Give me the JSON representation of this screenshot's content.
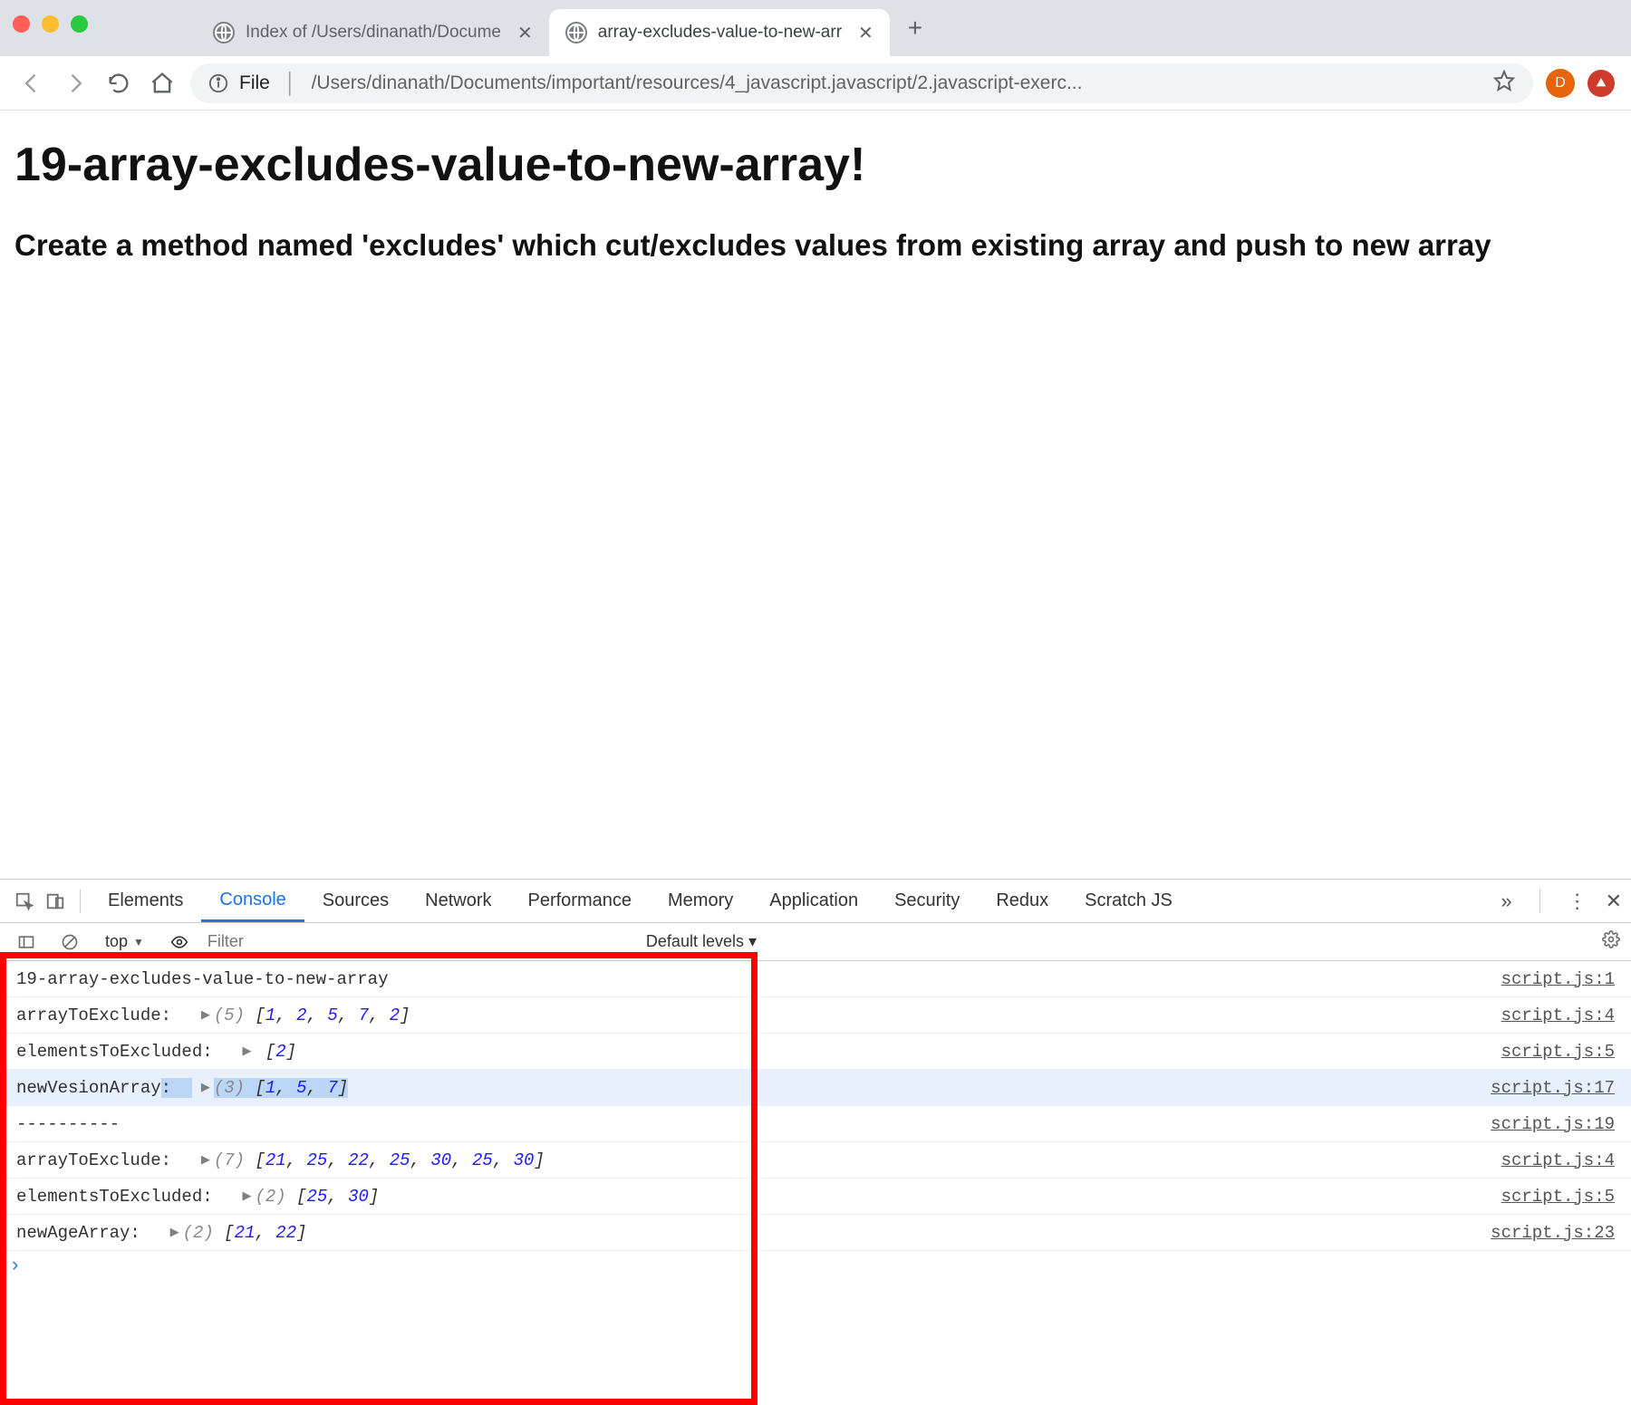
{
  "browser": {
    "tabs": [
      {
        "title": "Index of /Users/dinanath/Docume",
        "active": false
      },
      {
        "title": "array-excludes-value-to-new-arr",
        "active": true
      }
    ],
    "newTabGlyph": "+",
    "nav": {
      "back": "←",
      "forward": "→",
      "reload": "⟳",
      "home": "⌂"
    },
    "omnibox": {
      "scheme": "File",
      "path": "/Users/dinanath/Documents/important/resources/4_javascript.javascript/2.javascript-exerc..."
    },
    "avatar": "D"
  },
  "page": {
    "h1": "19-array-excludes-value-to-new-array!",
    "h2": "Create a method named 'excludes' which cut/excludes values from existing array and push to new array"
  },
  "devtools": {
    "tabs": [
      "Elements",
      "Console",
      "Sources",
      "Network",
      "Performance",
      "Memory",
      "Application",
      "Security",
      "Redux",
      "Scratch JS"
    ],
    "activeTab": "Console",
    "more": "»",
    "context": "top",
    "filterPlaceholder": "Filter",
    "levels": "Default levels ▾"
  },
  "console": {
    "rows": [
      {
        "label": "19-array-excludes-value-to-new-array",
        "src": "script.js:1"
      },
      {
        "label": "arrayToExclude:  ",
        "count": "(5)",
        "arr": " [1, 2, 5, 7, 2]",
        "nums": [
          1,
          2,
          5,
          7,
          2
        ],
        "src": "script.js:4"
      },
      {
        "label": "elementsToExcluded:  ",
        "arr": " [2]",
        "nums": [
          2
        ],
        "src": "script.js:5"
      },
      {
        "label": "newVesionArray:  ",
        "count": "(3)",
        "arr": " [1, 5, 7]",
        "nums": [
          1,
          5,
          7
        ],
        "src": "script.js:17",
        "highlight": true,
        "hlEnd": true
      },
      {
        "label": "----------",
        "src": "script.js:19"
      },
      {
        "label": "arrayToExclude:  ",
        "count": "(7)",
        "arr": " [21, 25, 22, 25, 30, 25, 30]",
        "nums": [
          21,
          25,
          22,
          25,
          30,
          25,
          30
        ],
        "src": "script.js:4"
      },
      {
        "label": "elementsToExcluded:  ",
        "count": "(2)",
        "arr": " [25, 30]",
        "nums": [
          25,
          30
        ],
        "src": "script.js:5"
      },
      {
        "label": "newAgeArray:  ",
        "count": "(2)",
        "arr": " [21, 22]",
        "nums": [
          21,
          22
        ],
        "src": "script.js:23"
      }
    ],
    "prompt": "›"
  }
}
